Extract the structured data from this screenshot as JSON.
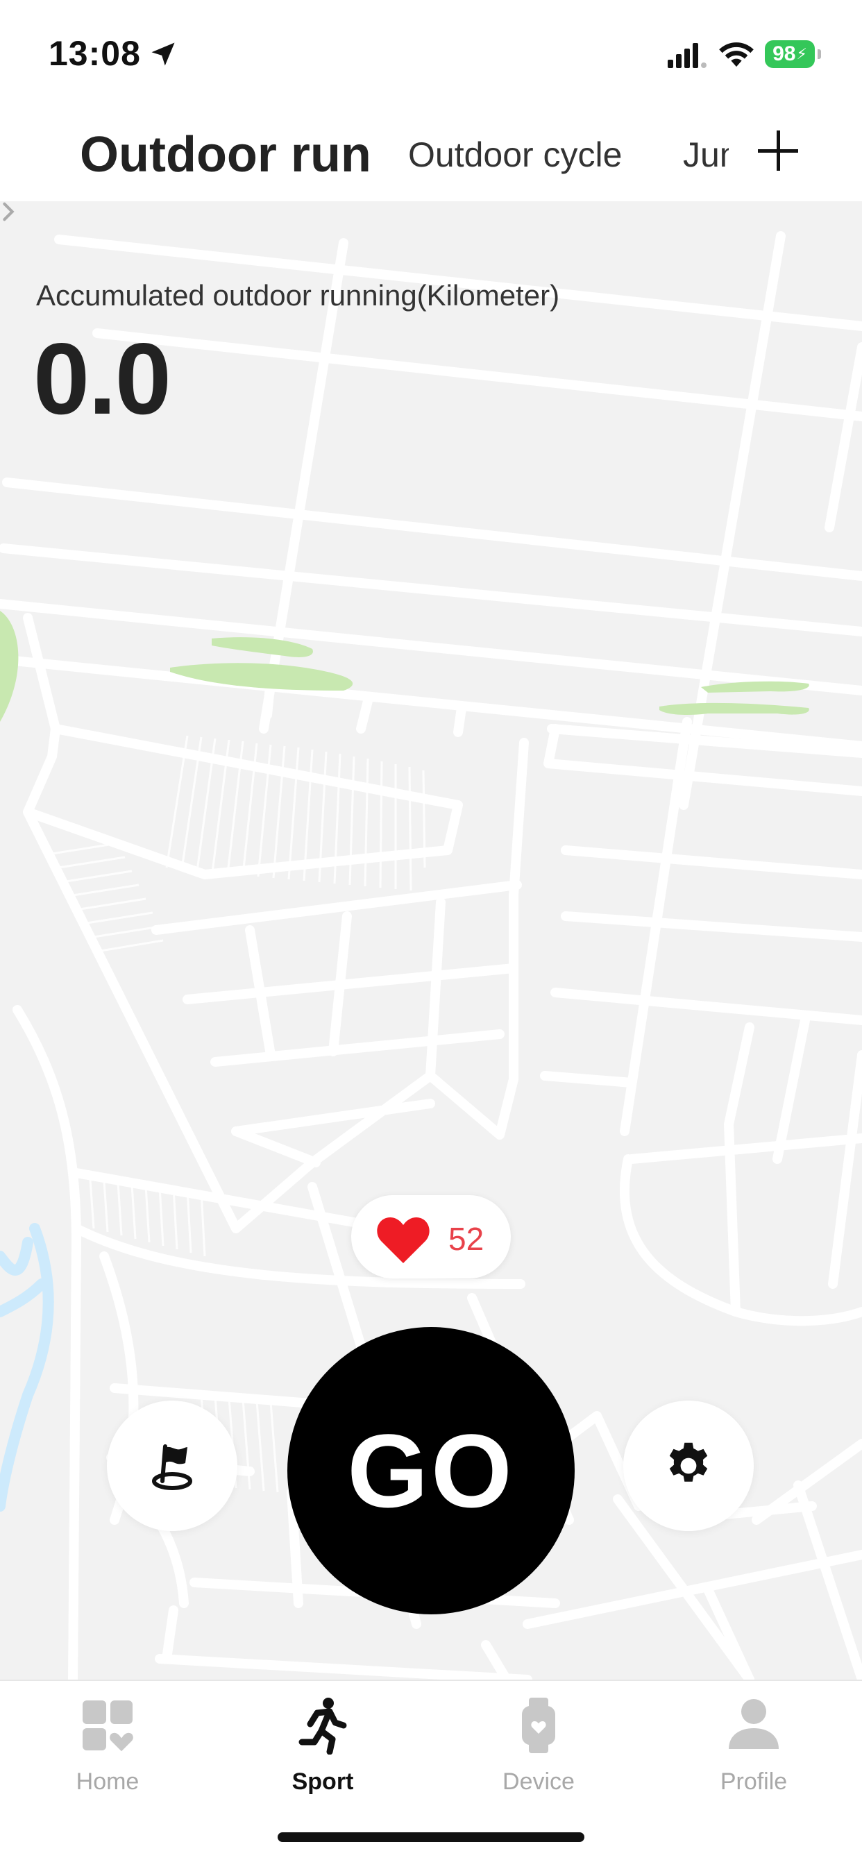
{
  "status_bar": {
    "time": "13:08",
    "battery": "98"
  },
  "header": {
    "tabs": [
      {
        "label": "Outdoor run",
        "active": true
      },
      {
        "label": "Outdoor cycle",
        "active": false
      },
      {
        "label": "Jump rope",
        "active": false
      }
    ]
  },
  "stats": {
    "label": "Accumulated outdoor running(Kilometer)",
    "value": "0.0"
  },
  "heart_rate": {
    "value": "52"
  },
  "controls": {
    "go_label": "GO"
  },
  "bottom_nav": {
    "items": [
      {
        "label": "Home",
        "icon": "home-icon",
        "active": false
      },
      {
        "label": "Sport",
        "icon": "running-icon",
        "active": true
      },
      {
        "label": "Device",
        "icon": "watch-icon",
        "active": false
      },
      {
        "label": "Profile",
        "icon": "person-icon",
        "active": false
      }
    ]
  },
  "colors": {
    "accent_heart": "#e8424a",
    "battery": "#34c759",
    "park": "#c8e8b0",
    "water": "#cdeafc",
    "map_bg": "#f2f2f2"
  }
}
